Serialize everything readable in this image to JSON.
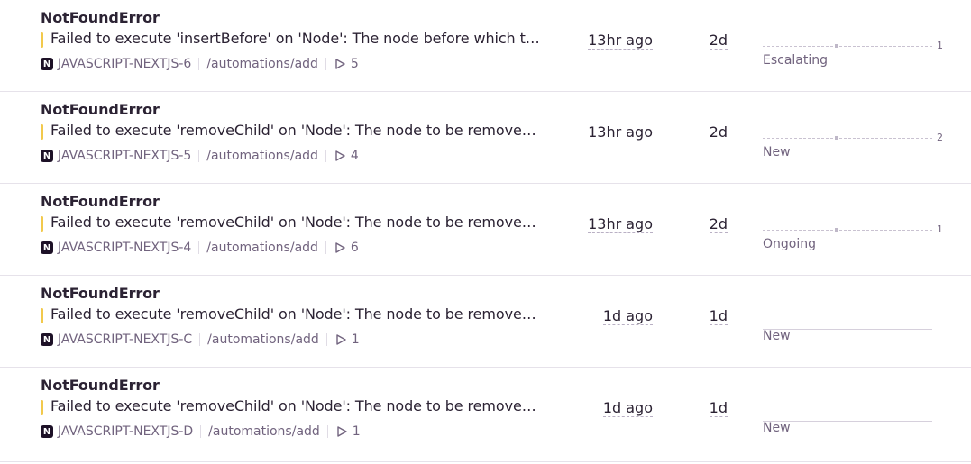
{
  "issues": [
    {
      "title": "NotFoundError",
      "message": "Failed to execute 'insertBefore' on 'Node': The node before which the new node is to be inserted is not a child of this node.",
      "project_icon": "N",
      "short_id": "JAVASCRIPT-NEXTJS-6",
      "culprit": "/automations/add",
      "events": "5",
      "last_seen": "13hr ago",
      "age": "2d",
      "graph_count": "1",
      "status": "Escalating",
      "accent": "#f2c94c"
    },
    {
      "title": "NotFoundError",
      "message": "Failed to execute 'removeChild' on 'Node': The node to be removed is not a child of this node.",
      "project_icon": "N",
      "short_id": "JAVASCRIPT-NEXTJS-5",
      "culprit": "/automations/add",
      "events": "4",
      "last_seen": "13hr ago",
      "age": "2d",
      "graph_count": "2",
      "status": "New",
      "accent": "#f2c94c"
    },
    {
      "title": "NotFoundError",
      "message": "Failed to execute 'removeChild' on 'Node': The node to be removed is not a child of this node.",
      "project_icon": "N",
      "short_id": "JAVASCRIPT-NEXTJS-4",
      "culprit": "/automations/add",
      "events": "6",
      "last_seen": "13hr ago",
      "age": "2d",
      "graph_count": "1",
      "status": "Ongoing",
      "accent": "#f2c94c"
    },
    {
      "title": "NotFoundError",
      "message": "Failed to execute 'removeChild' on 'Node': The node to be removed is not a child of this node.",
      "project_icon": "N",
      "short_id": "JAVASCRIPT-NEXTJS-C",
      "culprit": "/automations/add",
      "events": "1",
      "last_seen": "1d ago",
      "age": "1d",
      "graph_count": "",
      "status": "New",
      "accent": "#f2c94c"
    },
    {
      "title": "NotFoundError",
      "message": "Failed to execute 'removeChild' on 'Node': The node to be removed is not a child of this node.",
      "project_icon": "N",
      "short_id": "JAVASCRIPT-NEXTJS-D",
      "culprit": "/automations/add",
      "events": "1",
      "last_seen": "1d ago",
      "age": "1d",
      "graph_count": "",
      "status": "New",
      "accent": "#f2c94c"
    }
  ]
}
